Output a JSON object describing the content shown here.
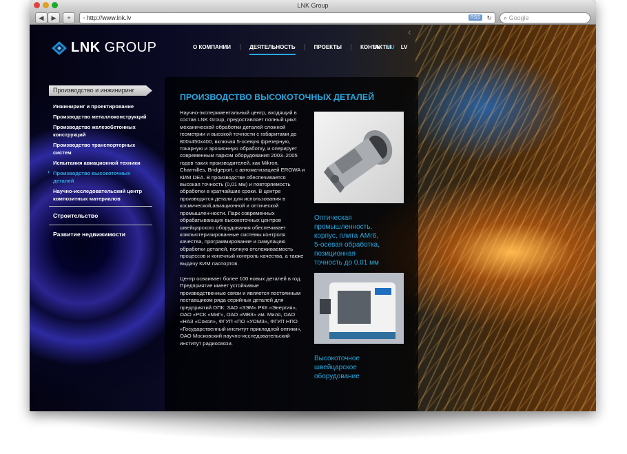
{
  "browser": {
    "window_title": "LNK Group",
    "url": "http://www.lnk.lv",
    "rss_label": "RSS",
    "search_placeholder": "Google"
  },
  "site": {
    "logo_bold": "LNK",
    "logo_rest": " GROUP",
    "nav": [
      "О КОМПАНИИ",
      "ДЕЯТЕЛЬНОСТЬ",
      "ПРОЕКТЫ",
      "КОНТАКТЫ"
    ],
    "active_nav": "ДЕЯТЕЛЬНОСТЬ",
    "languages": [
      "EN",
      "RU",
      "LV"
    ],
    "active_language": "RU"
  },
  "sidebar": {
    "heading": "Производство и инжиниринг",
    "items": [
      "Инжиниринг и проектирование",
      "Производство металлоконструкций",
      "Производство железобетонных конструкций",
      "Производство транспортерных систем",
      "Испытания авиационной техники",
      "Производство высокоточных деталей",
      "Научно-исследовательский центр композитных материалов"
    ],
    "active_item": "Производство высокоточных деталей",
    "sections": [
      "Строительство",
      "Развитие недвижимости"
    ]
  },
  "main": {
    "title": "ПРОИЗВОДСТВО ВЫСОКОТОЧНЫХ ДЕТАЛЕЙ",
    "paragraph1": "Научно-экспериментальный центр, входящий в состав LNK Group, предоставляет полный цикл механической обработки деталей сложной геометрии и высокой точности с габаритами до 800x450x400, включая 5-осевую фрезерную, токарную и эрозионную обработку, и оперирует современным парком оборудования 2003–2005 годов таких производителей, как Mikron, Charmilles, Bridgeport, с автоматизацией EROWA и КИМ DEA. В производстве обеспечивается высокая точность (0,01 мм) и повторяемость обработки в кратчайшие сроки. В центре производятся детали для использования в космической,авиационной и оптической промышлен-ности. Парк современных обрабатывающих высокоточных центров швейцарского оборудования обеспечивает компьютеризированные системы контроля качества, программирование и симулацию обработки деталей, полную отслеживаемость процессов и конечный контроль качества, а также выдачу КИМ паспортов.",
    "paragraph2": "Центр осваивает более 100 новых деталей в год. Предприятие имеет устойчивые производственные связи и является постоянным поставщиком ряда серийных деталей для предприятий ОПК: ЗАО «ЗЭМ» РКК «Энергия», ОАО «РСК «МиГ», ОАО «МВЗ» им. Миля, ОАО «НАЗ «Сокол», ФГУП «ПО «УОМЗ», ФГУП НПО «Государственный институт прикладной оптики», ОАО Московский научно-исследовательский институт радиосвязи.",
    "caption1": "Оптическая промышленность, корпус, плита АМг6, 5-осевая обработка, позиционная точность до 0.01 мм",
    "caption2": "Высокоточное швейцарское оборудование"
  },
  "colors": {
    "accent": "#29a8e0"
  }
}
